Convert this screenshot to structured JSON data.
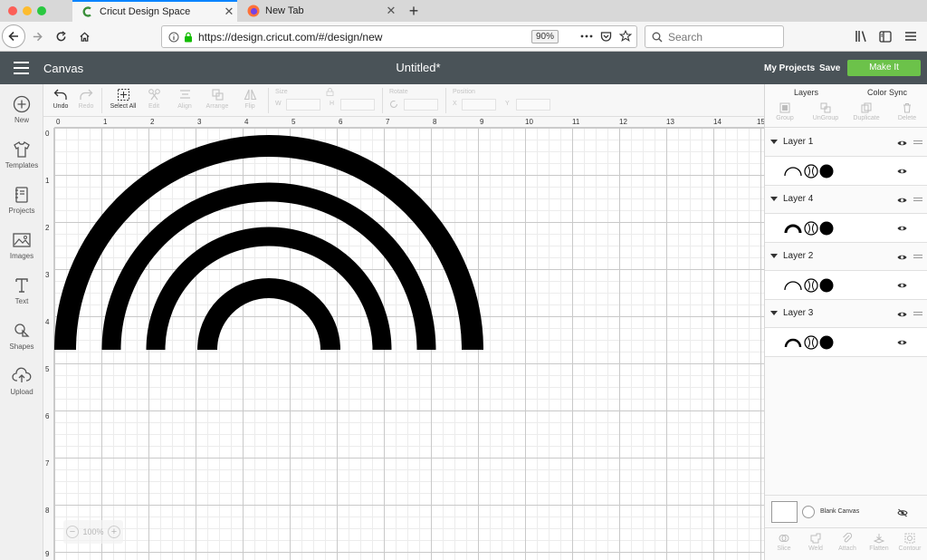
{
  "browser": {
    "tabs": [
      {
        "title": "Cricut Design Space",
        "active": true,
        "favicon": "cricut-c-icon"
      },
      {
        "title": "New Tab",
        "active": false,
        "favicon": "firefox-icon"
      }
    ],
    "close_glyph": "✕",
    "newtab_glyph": "+",
    "url": "https://design.cricut.com/#/design/new",
    "zoom": "90%",
    "search_placeholder": "Search"
  },
  "header": {
    "section": "Canvas",
    "doc_title": "Untitled*",
    "my_projects": "My Projects",
    "save": "Save",
    "make_it": "Make It",
    "make_it_color": "#6cc24a"
  },
  "left_tools": [
    {
      "label": "New",
      "icon": "plus-circle-icon"
    },
    {
      "label": "Templates",
      "icon": "tshirt-icon"
    },
    {
      "label": "Projects",
      "icon": "notebook-icon"
    },
    {
      "label": "Images",
      "icon": "image-icon"
    },
    {
      "label": "Text",
      "icon": "text-icon"
    },
    {
      "label": "Shapes",
      "icon": "shapes-icon"
    },
    {
      "label": "Upload",
      "icon": "cloud-upload-icon"
    }
  ],
  "edit_tools": {
    "undo": "Undo",
    "redo": "Redo",
    "select_all": "Select All",
    "edit": "Edit",
    "align": "Align",
    "arrange": "Arrange",
    "flip": "Flip",
    "size": "Size",
    "w": "W",
    "h": "H",
    "rotate": "Rotate",
    "position": "Position",
    "x": "X",
    "y": "Y"
  },
  "canvas": {
    "ruler_top": [
      "0",
      "1",
      "2",
      "3",
      "4",
      "5",
      "6",
      "7",
      "8",
      "9",
      "10",
      "11",
      "12",
      "13",
      "14",
      "15"
    ],
    "ruler_left": [
      "0",
      "1",
      "2",
      "3",
      "4",
      "5",
      "6",
      "7",
      "8",
      "9"
    ],
    "zoom_minus": "−",
    "zoom": "100%",
    "zoom_plus": "+"
  },
  "layers_panel": {
    "tabs": [
      "Layers",
      "Color Sync"
    ],
    "tools": [
      "Group",
      "UnGroup",
      "Duplicate",
      "Delete"
    ],
    "layers": [
      {
        "name": "Layer 1"
      },
      {
        "name": "Layer 4"
      },
      {
        "name": "Layer 2"
      },
      {
        "name": "Layer 3"
      }
    ],
    "blank_canvas": "Blank Canvas",
    "bottom_tools": [
      "Slice",
      "Weld",
      "Attach",
      "Flatten",
      "Contour"
    ]
  }
}
